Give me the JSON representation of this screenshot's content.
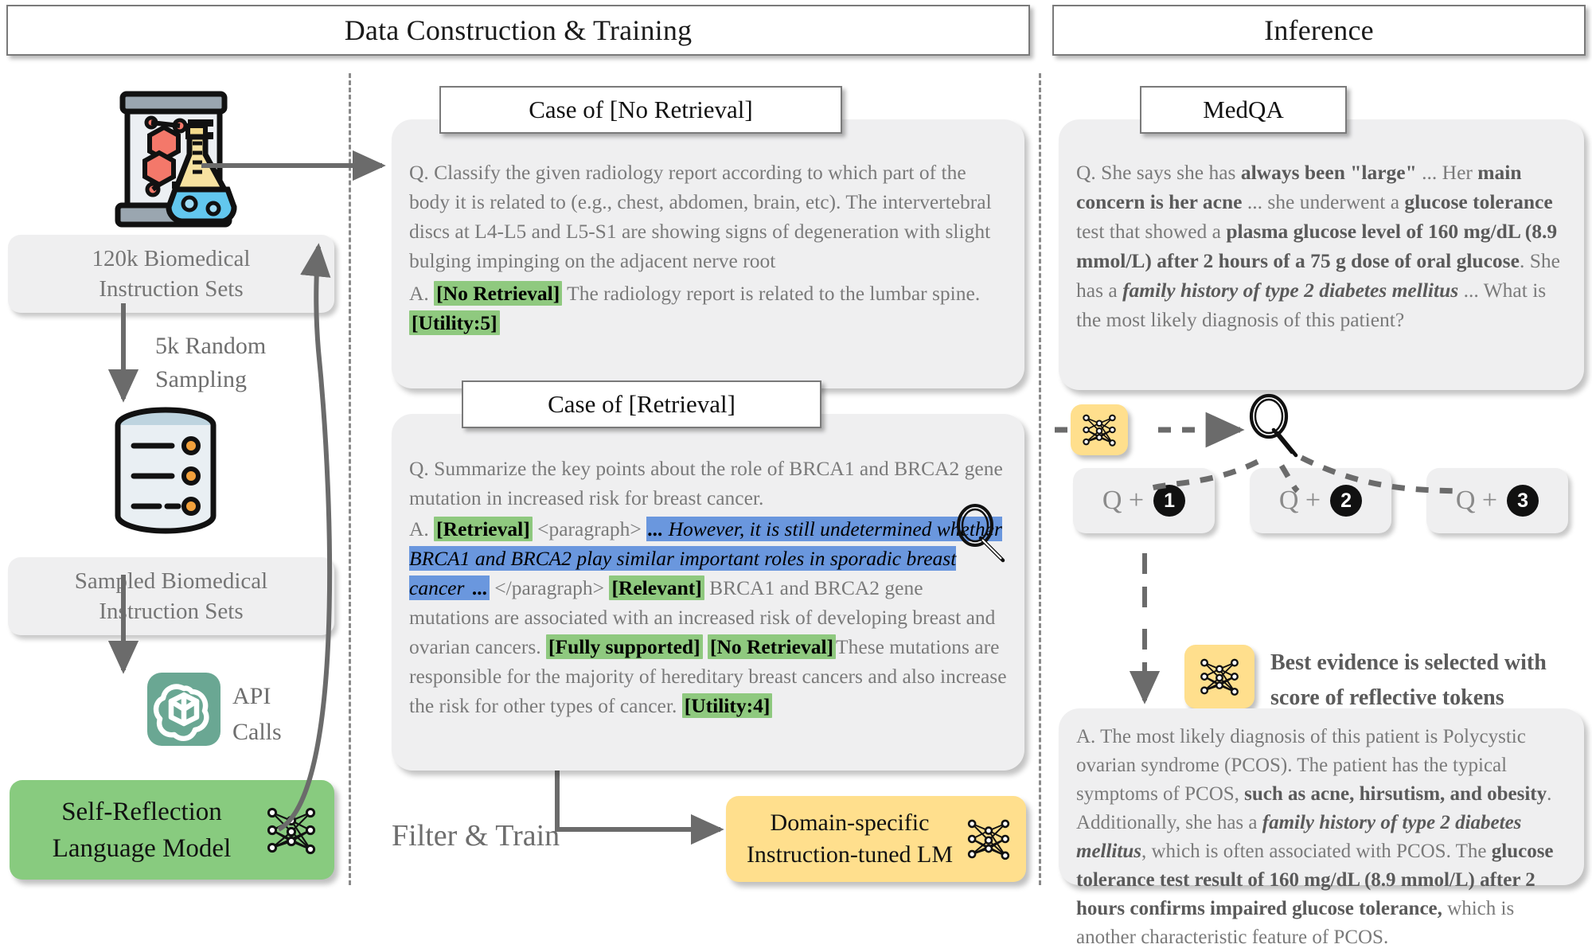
{
  "headers": {
    "left": "Data Construction & Training",
    "right": "Inference"
  },
  "left_pipeline": {
    "source_icon": "lab-flask-icon",
    "source_label": "120k Biomedical\nInstruction Sets",
    "source_label_line1": "120k Biomedical",
    "source_label_line2": "Instruction Sets",
    "sampling_arrow_label_line1": "5k Random",
    "sampling_arrow_label_line2": "Sampling",
    "database_icon": "database-icon",
    "sampled_label_line1": "Sampled Biomedical",
    "sampled_label_line2": "Instruction Sets",
    "api_icon": "openai-logo-icon",
    "api_label_line1": "API",
    "api_label_line2": "Calls",
    "reflection_model_line1": "Self-Reflection",
    "reflection_model_line2": "Language  Model",
    "reflection_model_icon": "neural-network-icon"
  },
  "case_no_retrieval": {
    "tab_label": "Case of [No Retrieval]",
    "question_prefix": "Q.",
    "question": "Classify the given radiology report according to which part of the body it is related to (e.g., chest, abdomen, brain, etc). The intervertebral discs at L4-L5 and L5-S1 are showing signs of degeneration with slight bulging impinging on the adjacent nerve root",
    "answer_prefix": "A.",
    "token_no_retrieval": "[No Retrieval]",
    "answer_body": " The radiology report is related to the lumbar spine. ",
    "token_utility": "[Utility:5]"
  },
  "case_retrieval": {
    "tab_label": "Case of [Retrieval]",
    "question_prefix": "Q.",
    "question": "Summarize the key points about the role of BRCA1 and BRCA2 gene mutation in increased risk for breast cancer.",
    "answer_prefix": "A.",
    "token_retrieval": "[Retrieval]",
    "paragraph_open": "<paragraph>",
    "evidence_ellipsis_lead": "... ",
    "evidence_text": "However, it is still undetermined whether BRCA1 and BRCA2 play similar important roles in sporadic breast cancer",
    "evidence_ellipsis_trail": " ...",
    "paragraph_close": "</paragraph>",
    "token_relevant": "[Relevant]",
    "answer_body_1": " BRCA1 and BRCA2 gene mutations are associated with an increased risk of developing breast and ovarian cancers. ",
    "token_fully_supported": "[Fully supported]",
    "token_no_retrieval": "[No Retrieval]",
    "answer_body_2": "These mutations are responsible for the majority of hereditary breast cancers and also increase the risk for other types of cancer. ",
    "token_utility": "[Utility:4]",
    "magnifier_icon": "magnifier-icon"
  },
  "train_flow": {
    "filter_label": "Filter & Train",
    "target_model_line1": "Domain-specific",
    "target_model_line2": "Instruction-tuned LM",
    "target_model_icon": "neural-network-icon"
  },
  "inference": {
    "medqa_tab": "MedQA",
    "question_prefix": "Q.",
    "q_seg1": "She says she has ",
    "q_b1": "always been \"large\"",
    "q_seg2": " ... Her ",
    "q_b2": "main concern is her acne",
    "q_seg3": " ... she underwent a ",
    "q_b3": "glucose tolerance",
    "q_seg4": " test that showed a ",
    "q_b4": "plasma glucose level of 160 mg/dL (8.9 mmol/L) after 2 hours of a 75 g dose of oral glucose",
    "q_seg5": ". She has a ",
    "q_i1": "family history of type 2 diabetes mellitus",
    "q_seg6": " ... What is the most likely diagnosis of this patient?",
    "retriever_icon": "magnifier-icon",
    "model_icon": "neural-network-icon",
    "candidates": [
      {
        "label": "Q +",
        "num": "1"
      },
      {
        "label": "Q +",
        "num": "2"
      },
      {
        "label": "Q +",
        "num": "3"
      }
    ],
    "selection_note_line1": "Best evidence is selected with",
    "selection_note_line2": "score of reflective tokens",
    "answer_prefix": "A.",
    "a_seg1": "The most likely diagnosis of this patient is Polycystic ovarian syndrome (PCOS). The patient has the typical symptoms of PCOS, ",
    "a_b1": "such as acne, hirsutism, and obesity",
    "a_seg2": ". Additionally, she has a ",
    "a_i1": "family history of type 2 diabetes mellitus",
    "a_seg3": ", which is often associated with PCOS. The ",
    "a_b2": "glucose tolerance test result of 160 mg/dL (8.9 mmol/L) after 2 hours confirms impaired glucose tolerance,",
    "a_seg4": " which is another characteristic feature of PCOS."
  },
  "colors": {
    "green_highlight": "#8fc97f",
    "blue_highlight": "#6a97de",
    "panel_bg": "#efeff0",
    "model_green": "#88cb7f",
    "model_yellow": "#ffdf8d",
    "text_gray": "#757575"
  }
}
